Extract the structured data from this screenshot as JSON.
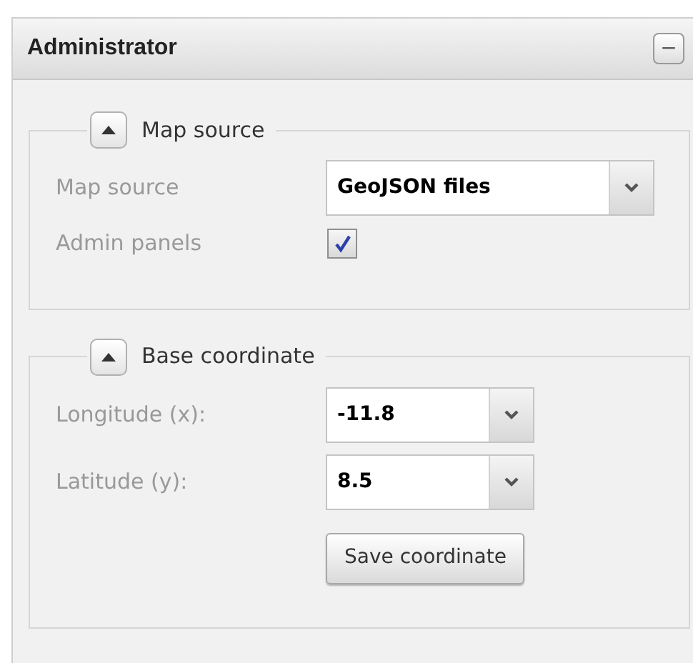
{
  "panel": {
    "title": "Administrator",
    "collapse_button": "−"
  },
  "sections": [
    {
      "title": "Map source",
      "expanded": true,
      "rows": [
        {
          "kind": "select",
          "label": "Map source",
          "value": "GeoJSON files",
          "wide": true
        },
        {
          "kind": "checkbox",
          "label": "Admin panels",
          "checked": true
        }
      ]
    },
    {
      "title": "Base coordinate",
      "expanded": true,
      "rows": [
        {
          "kind": "select",
          "label": "Longitude (x):",
          "value": "-11.8",
          "wide": false
        },
        {
          "kind": "select",
          "label": "Latitude (y):",
          "value": "8.5",
          "wide": false
        },
        {
          "kind": "button",
          "label": "Save coordinate"
        }
      ]
    }
  ]
}
